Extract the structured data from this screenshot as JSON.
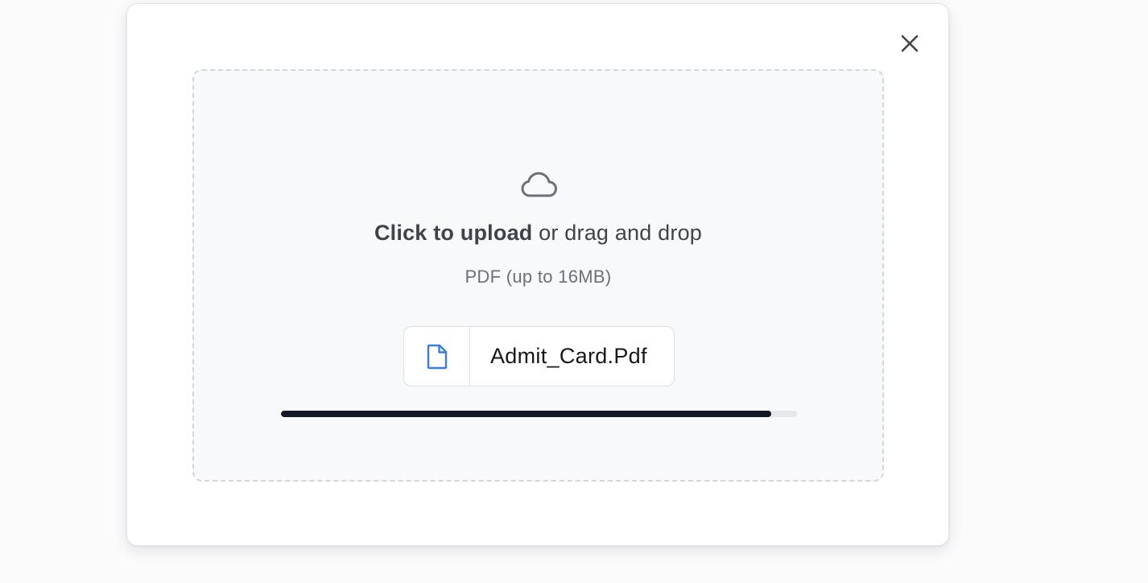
{
  "dialog": {
    "close_icon": "close-icon"
  },
  "dropzone": {
    "icon": "cloud-icon",
    "upload_action": "Click to upload",
    "upload_rest": " or drag and drop",
    "hint": "PDF (up to 16MB)"
  },
  "file": {
    "icon": "file-icon",
    "icon_color": "#3b7ddd",
    "name": "Admit_Card.Pdf",
    "progress_percent": 95
  },
  "colors": {
    "progress_fill": "#121826",
    "progress_track": "#e6e7ea"
  }
}
